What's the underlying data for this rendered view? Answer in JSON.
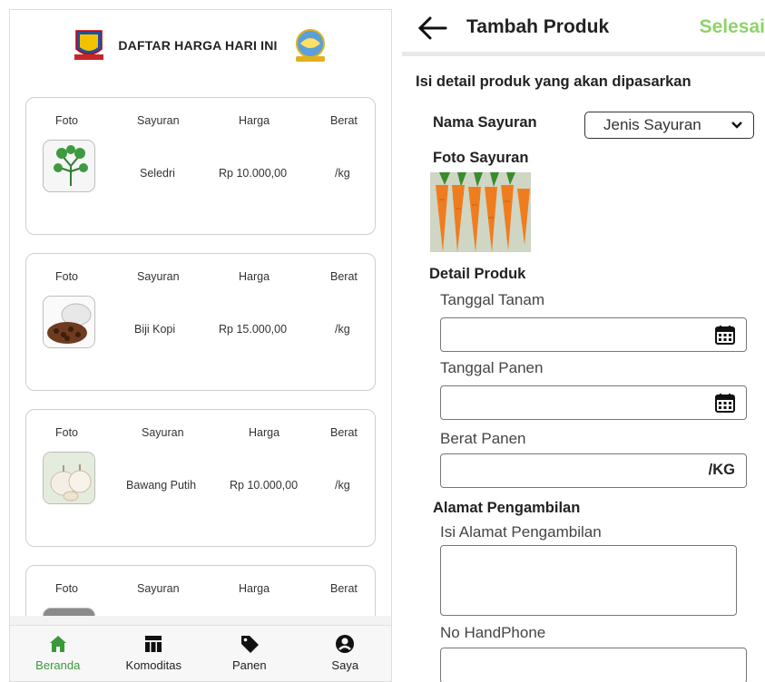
{
  "left": {
    "header": {
      "title": "DAFTAR HARGA HARI INI"
    },
    "columns": {
      "foto": "Foto",
      "sayuran": "Sayuran",
      "harga": "Harga",
      "berat": "Berat"
    },
    "items": [
      {
        "name": "Seledri",
        "price": "Rp 10.000,00",
        "unit": "/kg",
        "image": "celery-image"
      },
      {
        "name": "Biji Kopi",
        "price": "Rp 15.000,00",
        "unit": "/kg",
        "image": "coffee-beans-image"
      },
      {
        "name": "Bawang Putih",
        "price": "Rp 10.000,00",
        "unit": "/kg",
        "image": "garlic-image"
      }
    ],
    "nav": [
      {
        "label": "Beranda",
        "icon": "home-icon",
        "active": true
      },
      {
        "label": "Komoditas",
        "icon": "table-icon",
        "active": false
      },
      {
        "label": "Panen",
        "icon": "tag-icon",
        "active": false
      },
      {
        "label": "Saya",
        "icon": "user-icon",
        "active": false
      }
    ]
  },
  "right": {
    "header": {
      "title": "Tambah Produk",
      "action": "Selesai"
    },
    "subtitle": "Isi detail produk yang akan dipasarkan",
    "nama_label": "Nama Sayuran",
    "select_value": "Jenis Sayuran",
    "foto_label": "Foto Sayuran",
    "detail_label": "Detail Produk",
    "tanggal_tanam": "Tanggal Tanam",
    "tanggal_panen": "Tanggal Panen",
    "berat_panen": "Berat Panen",
    "berat_unit": "/KG",
    "alamat_label": "Alamat Pengambilan",
    "alamat_placeholder": "Isi Alamat Pengambilan",
    "phone_label": "No HandPhone"
  },
  "colors": {
    "accent_green": "#3a9a3a",
    "done_green": "#8ed36a"
  }
}
